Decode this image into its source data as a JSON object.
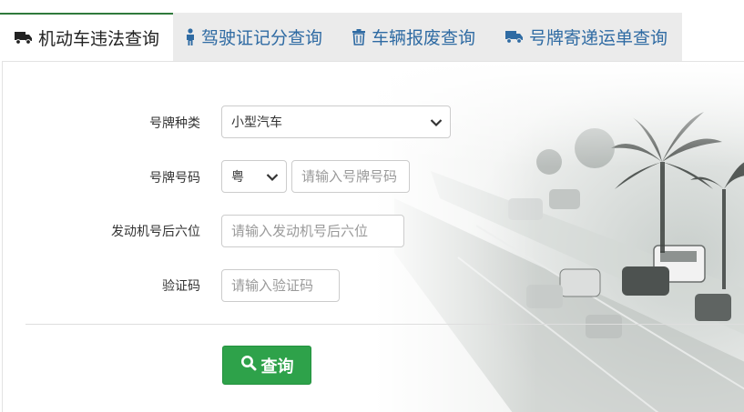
{
  "tabs": [
    {
      "label": "机动车违法查询",
      "icon": "truck-icon",
      "active": true
    },
    {
      "label": "驾驶证记分查询",
      "icon": "person-icon",
      "active": false
    },
    {
      "label": "车辆报废查询",
      "icon": "trash-icon",
      "active": false
    },
    {
      "label": "号牌寄递运单查询",
      "icon": "truck-icon",
      "active": false
    }
  ],
  "form": {
    "plate_type": {
      "label": "号牌种类",
      "value": "小型汽车"
    },
    "plate_number": {
      "label": "号牌号码",
      "province": "粤",
      "placeholder": "请输入号牌号码"
    },
    "engine": {
      "label": "发动机号后六位",
      "placeholder": "请输入发动机号后六位"
    },
    "captcha": {
      "label": "验证码",
      "placeholder": "请输入验证码"
    }
  },
  "submit": {
    "label": "查询",
    "icon": "search-icon"
  },
  "colors": {
    "accent_green": "#2ea24a",
    "tab_link": "#2f6ba3",
    "active_tab_border": "#2f7a3c"
  }
}
